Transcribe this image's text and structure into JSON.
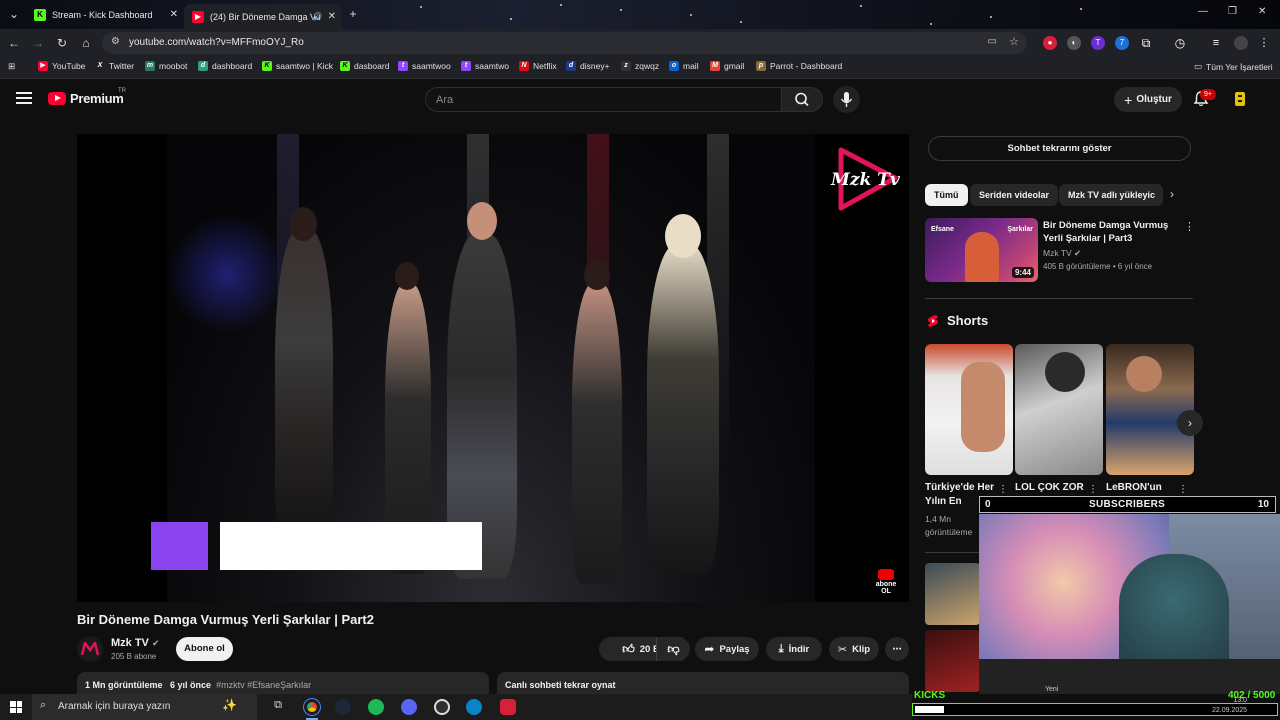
{
  "browser": {
    "tabs": [
      {
        "title": "Stream - Kick Dashboard",
        "favicon": "kick-icon",
        "color": "#53fc18"
      },
      {
        "title": "(24) Bir Döneme Damga Vu",
        "favicon": "youtube-icon",
        "color": "#ff0033"
      }
    ],
    "url": "youtube.com/watch?v=MFFmoOYJ_Ro",
    "bookmarks": [
      "YouTube",
      "Twitter",
      "moobot",
      "dashboard",
      "saamtwo | Kick",
      "dasboard",
      "saamtwoo",
      "saamtwo",
      "Netflix",
      "disney+",
      "zqwqz",
      "mail",
      "gmail",
      "Parrot - Dashboard"
    ],
    "all_bookmarks": "Tüm Yer İşaretleri"
  },
  "yt": {
    "brand": "Premium",
    "country": "TR",
    "search_placeholder": "Ara",
    "create_label": "Oluştur",
    "notif_badge": "9+"
  },
  "video": {
    "title": "Bir Döneme Damga Vurmuş Yerli Şarkılar | Part2",
    "channel": "Mzk TV",
    "subs": "205 B abone",
    "subscribe_label": "Abone ol",
    "likes": "20 B",
    "share": "Paylaş",
    "download": "İndir",
    "clip": "Klip",
    "views": "1 Mn görüntüleme",
    "age": "6 yıl önce",
    "tags": "#mzktv #EfsaneŞarkılar",
    "replay_chat": "Canlı sohbeti tekrar oynat",
    "overlay_logo": "Mzk Tv",
    "overlay_sub": "abone OL"
  },
  "side": {
    "chat_replay": "Sohbet tekrarını göster",
    "chips": [
      "Tümü",
      "Seriden videolar",
      "Mzk TV adlı yükleyic"
    ],
    "rec1": {
      "title": "Bir Döneme Damga Vurmuş Yerli Şarkılar | Part3",
      "channel": "Mzk TV",
      "meta": "405 B görüntüleme • 6 yıl önce",
      "duration": "9:44",
      "thumb_left": "Efsane",
      "thumb_right": "Şarkılar"
    },
    "shorts_heading": "Shorts",
    "shorts": [
      {
        "title": "Türkiye'de Her Yılın En"
      },
      {
        "title": "LOL ÇOK ZOR OYUN ..."
      },
      {
        "title": "LeBRON'un"
      }
    ],
    "short1_meta": "1,4 Mn görüntüleme"
  },
  "overlay": {
    "subs_left": "0",
    "subs_label": "SUBSCRIBERS",
    "subs_right": "10",
    "kicks_label": "KICKS",
    "kicks_count": "402 / 5000",
    "kicks_progress": 0.0804,
    "webcam_caption": "Yeni"
  },
  "taskbar": {
    "search_placeholder": "Aramak için buraya yazın",
    "time": "13:0",
    "date": "22.09.2025"
  }
}
